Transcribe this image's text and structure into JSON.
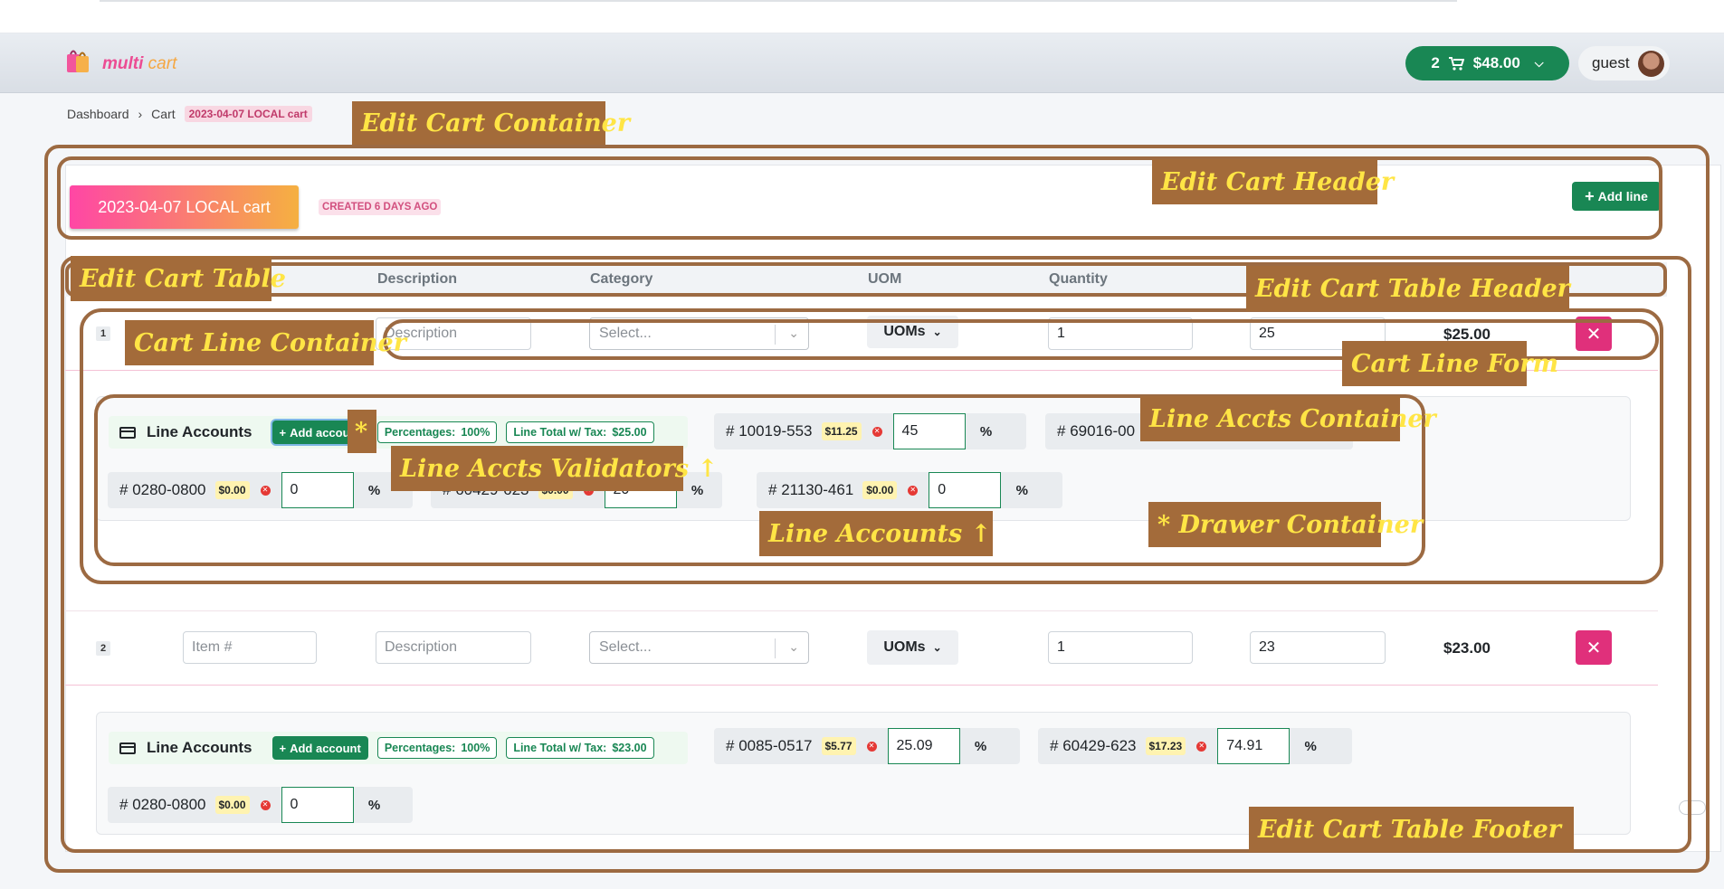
{
  "navbar": {
    "logo_word1": "multi",
    "logo_word2": "cart",
    "cart_count": "2",
    "cart_total": "$48.00",
    "user": "guest"
  },
  "breadcrumb": {
    "items": [
      "Dashboard",
      "Cart"
    ],
    "current": "2023-04-07 LOCAL cart"
  },
  "cart": {
    "title": "2023-04-07 LOCAL cart",
    "created": "CREATED 6 DAYS AGO",
    "add_line_label": "Add line"
  },
  "table": {
    "headers": [
      "Description",
      "Category",
      "UOM",
      "Quantity"
    ]
  },
  "lines": [
    {
      "num": "1",
      "description_placeholder": "Description",
      "category_placeholder": "Select...",
      "uom": "UOMs",
      "quantity": "1",
      "price": "25",
      "total": "$25.00",
      "accounts_title": "Line Accounts",
      "add_account": "Add account",
      "percentages_label": "Percentages:",
      "percentages_value": "100%",
      "line_total_label": "Line Total w/ Tax:",
      "line_total_value": "$25.00",
      "accounts": [
        {
          "number": "10019-553",
          "amount": "$11.25",
          "pct": "45"
        },
        {
          "number": "69016-00",
          "amount": "",
          "pct": ""
        },
        {
          "number": "0280-0800",
          "amount": "$0.00",
          "pct": "0"
        },
        {
          "number": "60429-623",
          "amount": "$0.00",
          "pct": "20"
        },
        {
          "number": "21130-461",
          "amount": "$0.00",
          "pct": "0"
        }
      ]
    },
    {
      "num": "2",
      "item_placeholder": "Item #",
      "description_placeholder": "Description",
      "category_placeholder": "Select...",
      "uom": "UOMs",
      "quantity": "1",
      "price": "23",
      "total": "$23.00",
      "accounts_title": "Line Accounts",
      "add_account": "Add account",
      "percentages_label": "Percentages:",
      "percentages_value": "100%",
      "line_total_label": "Line Total w/ Tax:",
      "line_total_value": "$23.00",
      "accounts": [
        {
          "number": "0085-0517",
          "amount": "$5.77",
          "pct": "25.09"
        },
        {
          "number": "60429-623",
          "amount": "$17.23",
          "pct": "74.91"
        },
        {
          "number": "0280-0800",
          "amount": "$0.00",
          "pct": "0"
        }
      ]
    }
  ],
  "annotations": {
    "edit_cart_container": "Edit Cart Container",
    "edit_cart_header": "Edit Cart Header",
    "edit_cart_table": "Edit Cart Table",
    "edit_cart_table_header": "Edit Cart Table Header",
    "cart_line_container": "Cart Line Container",
    "cart_line_form": "Cart Line Form",
    "line_accts_container": "Line Accts Container",
    "star": "*",
    "line_accts_validators": "Line Accts Validators ↑",
    "line_accounts": "Line Accounts ↑",
    "drawer_container": "* Drawer Container",
    "edit_cart_table_footer": "Edit Cart Table Footer"
  },
  "colors": {
    "success": "#198754",
    "danger": "#e0307b",
    "annotation_fill": "#a36b3a",
    "annotation_text": "#ffe545",
    "annotation_border": "#9c6a42"
  }
}
